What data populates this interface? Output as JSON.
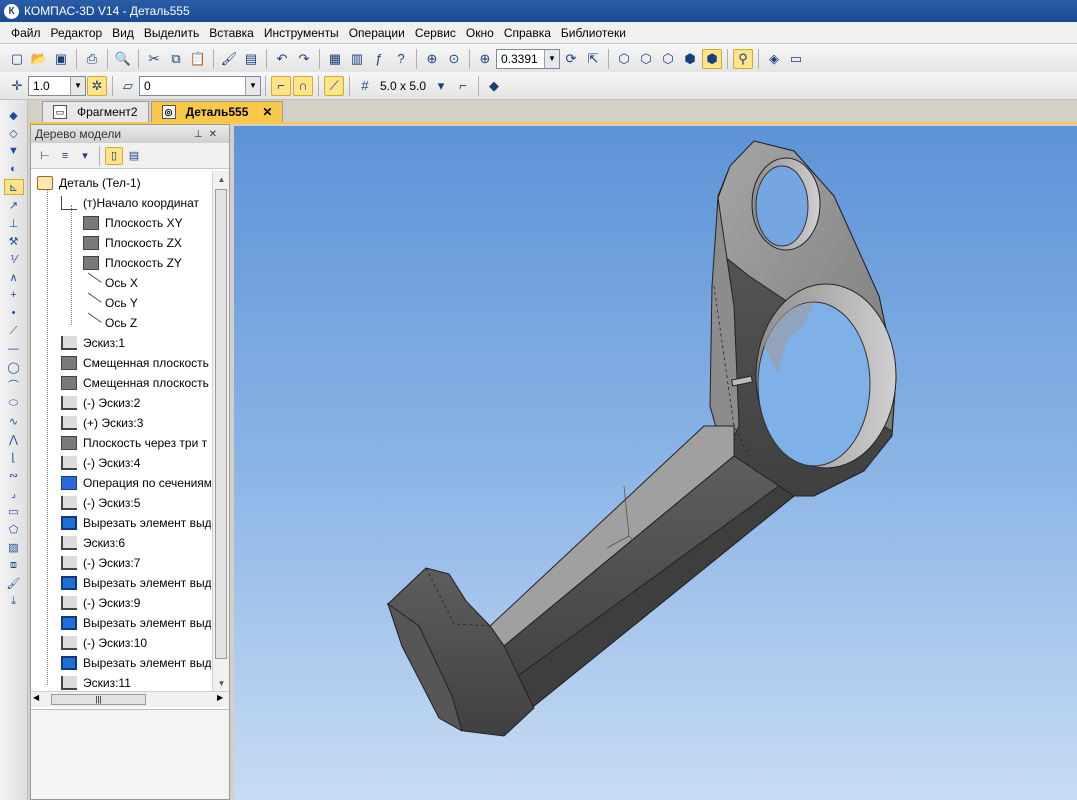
{
  "window": {
    "title": "КОМПАС-3D V14 - Деталь555",
    "app_icon": "К"
  },
  "menu": [
    "Файл",
    "Редактор",
    "Вид",
    "Выделить",
    "Вставка",
    "Инструменты",
    "Операции",
    "Сервис",
    "Окно",
    "Справка",
    "Библиотеки"
  ],
  "toolbar": {
    "zoom_value": "0.3391"
  },
  "toolbar2": {
    "step_value": "1.0",
    "layer_value": "0",
    "grid_value": "5.0 x 5.0"
  },
  "tabs": [
    {
      "label": "Фрагмент2",
      "active": false
    },
    {
      "label": "Деталь555",
      "active": true
    }
  ],
  "tree": {
    "panel_title": "Дерево модели",
    "items": [
      {
        "label": "Деталь (Тел-1)",
        "icon": "part-icon",
        "level": 0
      },
      {
        "label": "(т)Начало координат",
        "icon": "origin-icon",
        "level": 1
      },
      {
        "label": "Плоскость XY",
        "icon": "plane-icon",
        "level": 2
      },
      {
        "label": "Плоскость ZX",
        "icon": "plane-icon",
        "level": 2
      },
      {
        "label": "Плоскость ZY",
        "icon": "plane-icon",
        "level": 2
      },
      {
        "label": "Ось X",
        "icon": "axis-icon",
        "level": 2
      },
      {
        "label": "Ось Y",
        "icon": "axis-icon",
        "level": 2
      },
      {
        "label": "Ось Z",
        "icon": "axis-icon",
        "level": 2
      },
      {
        "label": "Эскиз:1",
        "icon": "sketch-icon",
        "level": 1
      },
      {
        "label": "Смещенная плоскость",
        "icon": "plane-icon",
        "level": 1
      },
      {
        "label": "Смещенная плоскость",
        "icon": "plane-icon",
        "level": 1
      },
      {
        "label": "(-) Эскиз:2",
        "icon": "sketch-icon",
        "level": 1
      },
      {
        "label": "(+) Эскиз:3",
        "icon": "sketch-icon",
        "level": 1
      },
      {
        "label": "Плоскость через три т",
        "icon": "plane-icon",
        "level": 1
      },
      {
        "label": "(-) Эскиз:4",
        "icon": "sketch-icon",
        "level": 1
      },
      {
        "label": "Операция по сечениям",
        "icon": "loft-icon",
        "level": 1
      },
      {
        "label": "(-) Эскиз:5",
        "icon": "sketch-icon",
        "level": 1
      },
      {
        "label": "Вырезать элемент выд",
        "icon": "cut-icon",
        "level": 1
      },
      {
        "label": "Эскиз:6",
        "icon": "sketch-icon",
        "level": 1
      },
      {
        "label": "(-) Эскиз:7",
        "icon": "sketch-icon",
        "level": 1
      },
      {
        "label": "Вырезать элемент выд",
        "icon": "cut-icon",
        "level": 1
      },
      {
        "label": "(-) Эскиз:9",
        "icon": "sketch-icon",
        "level": 1
      },
      {
        "label": "Вырезать элемент выд",
        "icon": "cut-icon",
        "level": 1
      },
      {
        "label": "(-) Эскиз:10",
        "icon": "sketch-icon",
        "level": 1
      },
      {
        "label": "Вырезать элемент выд",
        "icon": "cut-icon",
        "level": 1
      },
      {
        "label": "Эскиз:11",
        "icon": "sketch-icon",
        "level": 1
      }
    ]
  },
  "colors": {
    "accent": "#f7c84a",
    "titlebar": "#1b4a94",
    "viewport_top": "#5d93d7",
    "viewport_bottom": "#c7dcf3",
    "part": "#6b6b6b"
  }
}
